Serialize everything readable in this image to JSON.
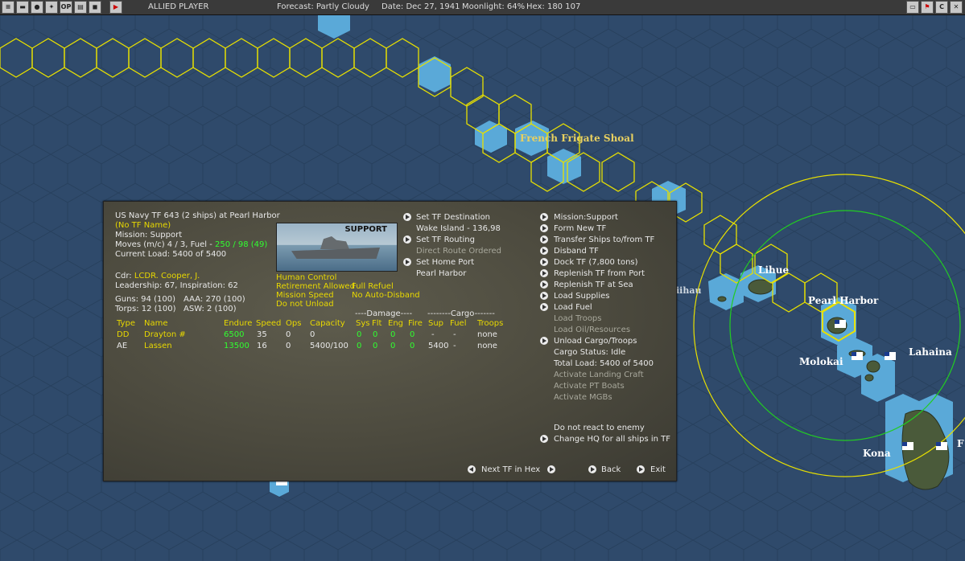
{
  "topbar": {
    "player": "ALLIED PLAYER",
    "forecast": "Forecast: Partly Cloudy",
    "date": "Date: Dec 27, 1941",
    "moonlight": "Moonlight: 64%",
    "hex": "Hex: 180 107",
    "icons": [
      "ships-icon",
      "air-icon",
      "globe-icon",
      "network-icon",
      "op-icon",
      "report-icon",
      "screen-icon",
      "end-turn-icon"
    ],
    "op_label": "OP",
    "right_icons": [
      "monitor-icon",
      "flag-icon",
      "c-icon",
      "close-icon"
    ],
    "c_label": "C"
  },
  "map": {
    "labels": {
      "french_frigate": "French Frigate Shoal",
      "lihue": "Lihue",
      "niihau": "iihau",
      "pearl": "Pearl Harbor",
      "lahaina": "Lahaina",
      "molokai": "Molokai",
      "kona": "Kona",
      "edge": "F"
    },
    "colors": {
      "sea": "#2f4a6b",
      "hex_line": "#e8e000",
      "radius_green": "#22cc22",
      "shallow": "#5aa9d8"
    }
  },
  "panel": {
    "title": "US Navy TF 643 (2 ships) at Pearl Harbor",
    "tf_name": "(No TF Name)",
    "mission": "Mission: Support",
    "moves_prefix": "Moves (m/c) 4 / 3, Fuel - ",
    "fuel": "250 / 98 (49)",
    "current_load": "Current Load: 5400 of 5400",
    "cdr_label": "Cdr:",
    "cdr_name": "LCDR. Cooper, J.",
    "leadership": "Leadership: 67, Inspiration: 62",
    "guns": "Guns: 94 (100)",
    "aaa": "AAA: 270 (100)",
    "torps": "Torps: 12 (100)",
    "asw": "ASW: 2 (100)",
    "image_label": "SUPPORT",
    "settings": {
      "human_control": "Human Control",
      "retirement": "Retirement Allowed",
      "full_refuel": "Full Refuel",
      "mission_speed": "Mission Speed",
      "no_auto_disband": "No Auto-Disband",
      "do_not_unload": "Do not Unload"
    },
    "routing": {
      "set_destination": "Set TF Destination",
      "destination": "Wake Island - 136,98",
      "set_routing": "Set TF Routing",
      "direct_route": "Direct Route Ordered",
      "set_home": "Set Home Port",
      "home_port": "Pearl Harbor"
    },
    "table": {
      "damage_group": "----Damage----",
      "cargo_group": "--------Cargo-------",
      "headers": [
        "Type",
        "Name",
        "Endure",
        "Speed",
        "Ops",
        "Capacity",
        "Sys",
        "Flt",
        "Eng",
        "Fire",
        "Sup",
        "Fuel",
        "Troops"
      ],
      "rows": [
        [
          "DD",
          "Drayton #",
          "6500",
          "35",
          "0",
          "0",
          "0",
          "0",
          "0",
          "0",
          "-",
          "-",
          "none"
        ],
        [
          "AE",
          "Lassen",
          "13500",
          "16",
          "0",
          "5400/100",
          "0",
          "0",
          "0",
          "0",
          "5400",
          "-",
          "none"
        ]
      ]
    },
    "commands": [
      {
        "label": "Mission:Support",
        "active": true
      },
      {
        "label": "Form New TF",
        "active": true
      },
      {
        "label": "Transfer Ships to/from TF",
        "active": true
      },
      {
        "label": "Disband TF",
        "active": true
      },
      {
        "label": "Dock TF (7,800 tons)",
        "active": true
      },
      {
        "label": "Replenish TF from Port",
        "active": true
      },
      {
        "label": "Replenish TF at Sea",
        "active": true
      },
      {
        "label": "Load Supplies",
        "active": true
      },
      {
        "label": "Load Fuel",
        "active": true
      },
      {
        "label": "Load Troops",
        "active": false
      },
      {
        "label": "Load Oil/Resources",
        "active": false
      },
      {
        "label": "Unload Cargo/Troops",
        "active": true
      },
      {
        "label": "Cargo Status: Idle",
        "active": false,
        "plain": true
      },
      {
        "label": "Total Load: 5400 of 5400",
        "active": false,
        "plain": true
      },
      {
        "label": "Activate Landing Craft",
        "active": false
      },
      {
        "label": "Activate PT Boats",
        "active": false
      },
      {
        "label": "Activate MGBs",
        "active": false
      }
    ],
    "no_react": "Do not react to enemy",
    "change_hq": "Change HQ for all ships in TF",
    "next_tf": "Next TF in Hex",
    "back": "Back",
    "exit": "Exit"
  }
}
